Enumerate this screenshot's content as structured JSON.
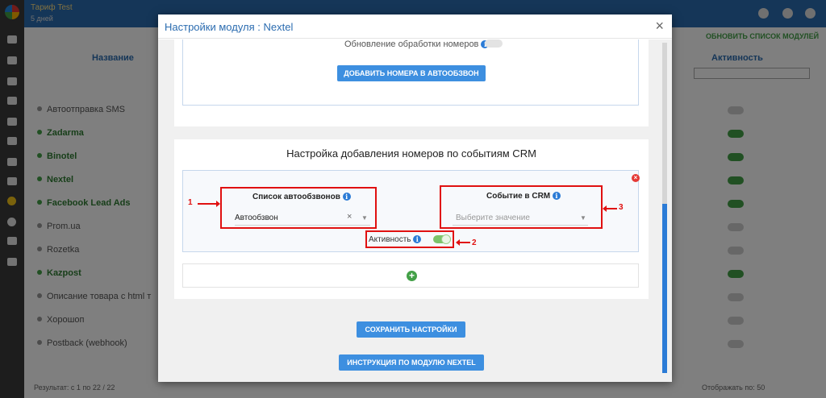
{
  "app": {
    "tariff": "Тариф Test",
    "tariff_sub": "5 дней",
    "refresh_button": "ОБНОВИТЬ СПИСОК МОДУЛЕЙ",
    "columns": {
      "name": "Название",
      "activity": "Активность"
    },
    "rows": [
      {
        "label": "Автоотправка SMS",
        "active": false
      },
      {
        "label": "Zadarma",
        "active": true
      },
      {
        "label": "Binotel",
        "active": true
      },
      {
        "label": "Nextel",
        "active": true
      },
      {
        "label": "Facebook Lead Ads",
        "active": true
      },
      {
        "label": "Prom.ua",
        "active": false
      },
      {
        "label": "Rozetka",
        "active": false
      },
      {
        "label": "Kazpost",
        "active": true
      },
      {
        "label": "Описание товара с html т",
        "active": false
      },
      {
        "label": "Хорошоп",
        "active": false
      },
      {
        "label": "Postback (webhook)",
        "active": false
      }
    ],
    "footer_results": "Результат: с 1 по 22 / 22",
    "footer_per_page": "Отображать по: 50"
  },
  "modal": {
    "title": "Настройки модуля : Nextel",
    "close_symbol": "×",
    "renew_label": "Обновление обработки номеров",
    "add_numbers_button": "ДОБАВИТЬ НОМЕРА В АВТООБЗВОН",
    "crm_section_title": "Настройка добавления номеров по событиям CRM",
    "crm_rule": {
      "list_label": "Список автообзвонов",
      "list_value": "Автообзвон",
      "event_label": "Событие в CRM",
      "event_placeholder": "Выберите значение",
      "activity_label": "Активность",
      "activity_enabled": true
    },
    "annotations": [
      "1",
      "2",
      "3"
    ],
    "save_button": "СОХРАНИТЬ НАСТРОЙКИ",
    "instruction_button": "ИНСТРУКЦИЯ ПО МОДУЛЮ NEXTEL"
  },
  "colors": {
    "accent": "#2b6cb0",
    "button": "#3d8fe0",
    "annotation": "#e01010",
    "active_green": "#43a047"
  }
}
